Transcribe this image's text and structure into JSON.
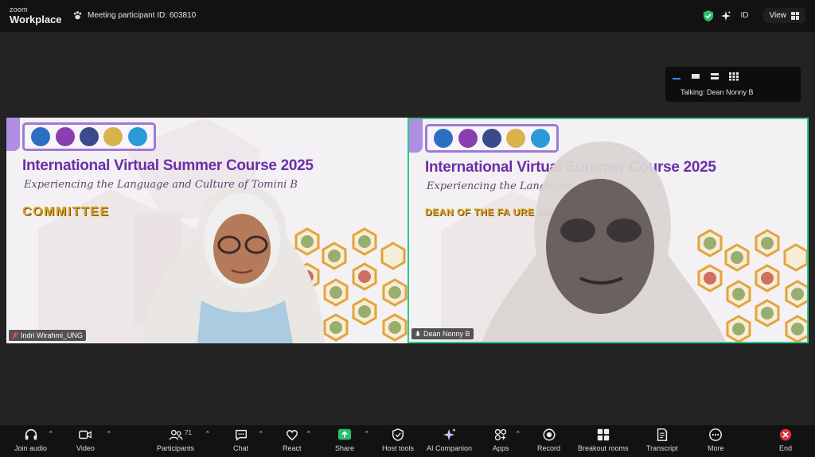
{
  "topbar": {
    "brand_small": "zoom",
    "brand": "Workplace",
    "meeting_id": "Meeting participant ID: 603810",
    "id_label": "ID",
    "view_label": "View"
  },
  "talking": {
    "label": "Talking: Dean Nonny B"
  },
  "tiles": [
    {
      "title": "International Virtual Summer Course 2025",
      "subtitle": "Experiencing the Language and Culture of Tomini B",
      "banner": "COMMITTEE",
      "name": "Indri Wirahmi_UNG"
    },
    {
      "title": "International Virtual Summer Course 2025",
      "subtitle": "Experiencing the Language",
      "banner": "DEAN OF THE FA                         URE AND CULTURE",
      "name": "Dean Nonny B"
    }
  ],
  "toolbar": {
    "join_audio": "Join audio",
    "video": "Video",
    "participants": "Participants",
    "participants_count": "71",
    "chat": "Chat",
    "react": "React",
    "share": "Share",
    "host_tools": "Host tools",
    "ai_companion": "AI Companion",
    "apps": "Apps",
    "record": "Record",
    "breakout_rooms": "Breakout rooms",
    "transcript": "Transcript",
    "more": "More",
    "end": "End"
  },
  "colors": {
    "accent_green": "#2fc58a",
    "share_green": "#2bbd6f",
    "title_purple": "#6b2fa8",
    "banner_gold": "#d9a520",
    "end_red": "#e0323e"
  }
}
